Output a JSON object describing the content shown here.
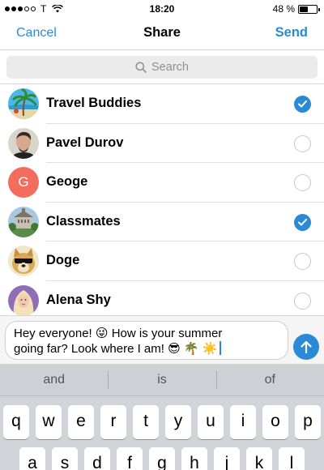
{
  "status_bar": {
    "carrier": "T",
    "time": "18:20",
    "battery_text": "48 %",
    "battery_level": 0.48,
    "signal_dots": [
      true,
      true,
      true,
      false,
      false
    ]
  },
  "nav": {
    "cancel_label": "Cancel",
    "title": "Share",
    "send_label": "Send"
  },
  "search": {
    "placeholder": "Search",
    "icon": "magnifier-icon"
  },
  "contacts": [
    {
      "name": "Travel Buddies",
      "selected": true,
      "avatar": "palm-beach-photo"
    },
    {
      "name": "Pavel Durov",
      "selected": false,
      "avatar": "person-photo"
    },
    {
      "name": "Geoge",
      "selected": false,
      "avatar": "initial-letter",
      "initial": "G",
      "color": "#f26d5b"
    },
    {
      "name": "Classmates",
      "selected": true,
      "avatar": "building-photo"
    },
    {
      "name": "Doge",
      "selected": false,
      "avatar": "dog-photo"
    },
    {
      "name": "Alena Shy",
      "selected": false,
      "avatar": "woman-photo"
    }
  ],
  "composer": {
    "message_line1": "Hey everyone! 😜  How is your summer",
    "message_line2": "going far? Look where I am! 😎 🌴 ☀️"
  },
  "keyboard": {
    "suggestions": [
      "and",
      "is",
      "of"
    ],
    "row1": [
      "q",
      "w",
      "e",
      "r",
      "t",
      "y",
      "u",
      "i",
      "o",
      "p"
    ],
    "row2": [
      "a",
      "s",
      "d",
      "f",
      "g",
      "h",
      "j",
      "k",
      "l"
    ]
  },
  "colors": {
    "accent": "#2a8ad6",
    "separator": "#e0e0e0"
  }
}
